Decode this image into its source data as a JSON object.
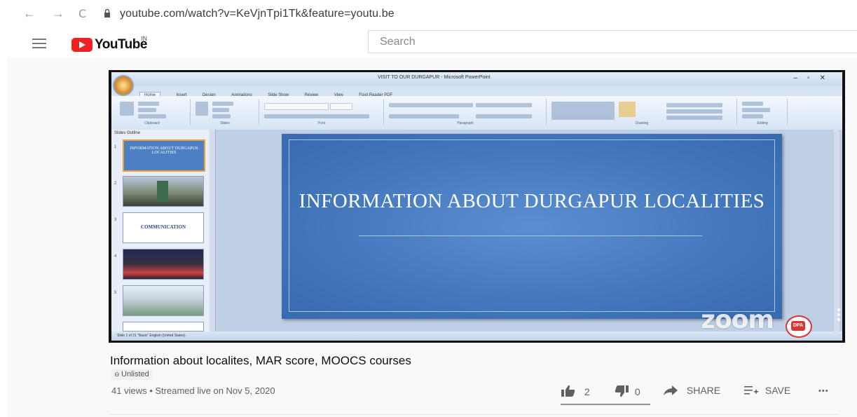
{
  "browser": {
    "back_icon": "←",
    "forward_icon": "→",
    "reload_icon": "C",
    "url": "youtube.com/watch?v=KeVjnTpi1Tk&feature=youtu.be"
  },
  "youtube": {
    "logo_text": "YouTube",
    "region": "IN",
    "search_placeholder": "Search"
  },
  "player": {
    "ppt_window_title": "VISIT TO OUR DURGAPUR - Microsoft PowerPoint",
    "ppt_tabs": [
      "Home",
      "Insert",
      "Design",
      "Animations",
      "Slide Show",
      "Review",
      "View",
      "Foxit Reader PDF"
    ],
    "ribbon_groups": [
      "Clipboard",
      "Slides",
      "Font",
      "Paragraph",
      "Drawing",
      "Editing"
    ],
    "pane_tabs": "Slides  Outline",
    "thumbnails": [
      {
        "num": "1",
        "text": "INFORMATION ABOUT DURGAPUR LOCALITIES"
      },
      {
        "num": "2",
        "text": ""
      },
      {
        "num": "3",
        "text": "COMMUNICATION"
      },
      {
        "num": "4",
        "text": ""
      },
      {
        "num": "5",
        "text": ""
      }
    ],
    "slide_title": "INFORMATION ABOUT DURGAPUR LOCALITIES",
    "status_text": "Slide 1 of 21    \"Basic\"    English (United States)",
    "watermark": "zoom"
  },
  "video": {
    "title": "Information about localites, MAR score, MOOCS courses",
    "privacy": "Unlisted",
    "views": "41 views",
    "streamed": "Streamed live on Nov 5, 2020",
    "likes": "2",
    "dislikes": "0",
    "share_label": "SHARE",
    "save_label": "SAVE",
    "more_label": "•••"
  }
}
